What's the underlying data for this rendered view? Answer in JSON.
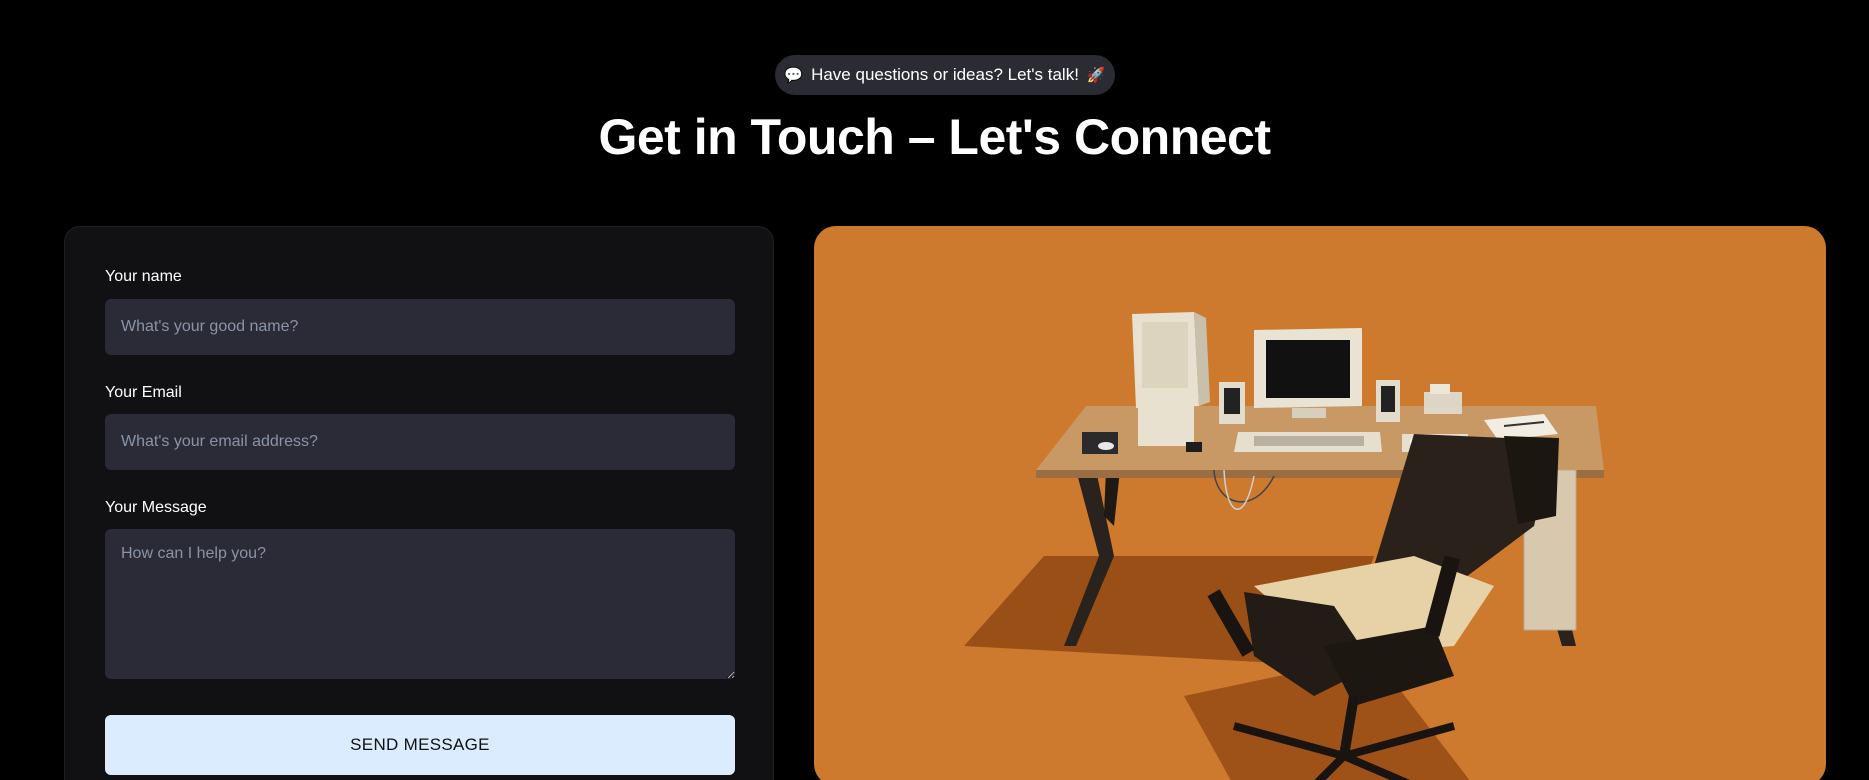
{
  "header": {
    "pill_emoji": "💬",
    "pill_text": "Have questions or ideas? Let's talk!",
    "pill_trailing_emoji": "🚀",
    "title": "Get in Touch – Let's Connect"
  },
  "form": {
    "name_label": "Your name",
    "name_placeholder": "What's your good name?",
    "email_label": "Your Email",
    "email_placeholder": "What's your email address?",
    "message_label": "Your Message",
    "message_placeholder": "How can I help you?",
    "submit_label": "SEND MESSAGE"
  },
  "colors": {
    "background": "#000000",
    "card": "#111114",
    "input": "#2b2b37",
    "button": "#dcecff",
    "scene": "#cd7a2e"
  }
}
